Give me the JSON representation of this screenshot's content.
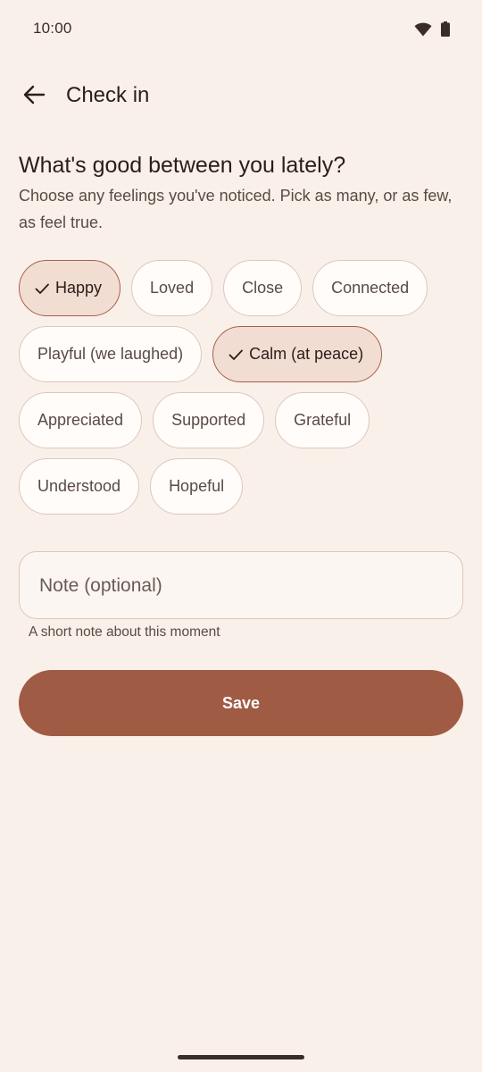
{
  "status_bar": {
    "time": "10:00",
    "icons": [
      "wifi-icon",
      "battery-icon"
    ]
  },
  "top_bar": {
    "back_icon": "arrow-back-icon",
    "title": "Check in"
  },
  "content": {
    "question": "What's good between you lately?",
    "helper": "Choose any feelings you've noticed. Pick as many, or as few, as feel true."
  },
  "feelings": [
    {
      "label": "Happy",
      "selected": true
    },
    {
      "label": "Loved",
      "selected": false
    },
    {
      "label": "Close",
      "selected": false
    },
    {
      "label": "Connected",
      "selected": false
    },
    {
      "label": "Playful (we laughed)",
      "selected": false
    },
    {
      "label": "Calm (at peace)",
      "selected": true
    },
    {
      "label": "Appreciated",
      "selected": false
    },
    {
      "label": "Supported",
      "selected": false
    },
    {
      "label": "Grateful",
      "selected": false
    },
    {
      "label": "Understood",
      "selected": false
    },
    {
      "label": "Hopeful",
      "selected": false
    }
  ],
  "note": {
    "placeholder": "Note (optional)",
    "value": "",
    "supporting_text": "A short note about this moment"
  },
  "save_label": "Save",
  "colors": {
    "background": "#faf0ea",
    "accent": "#a05b45",
    "chip_selected_bg": "#f2ddd3",
    "chip_border": "#dcc7bc"
  }
}
